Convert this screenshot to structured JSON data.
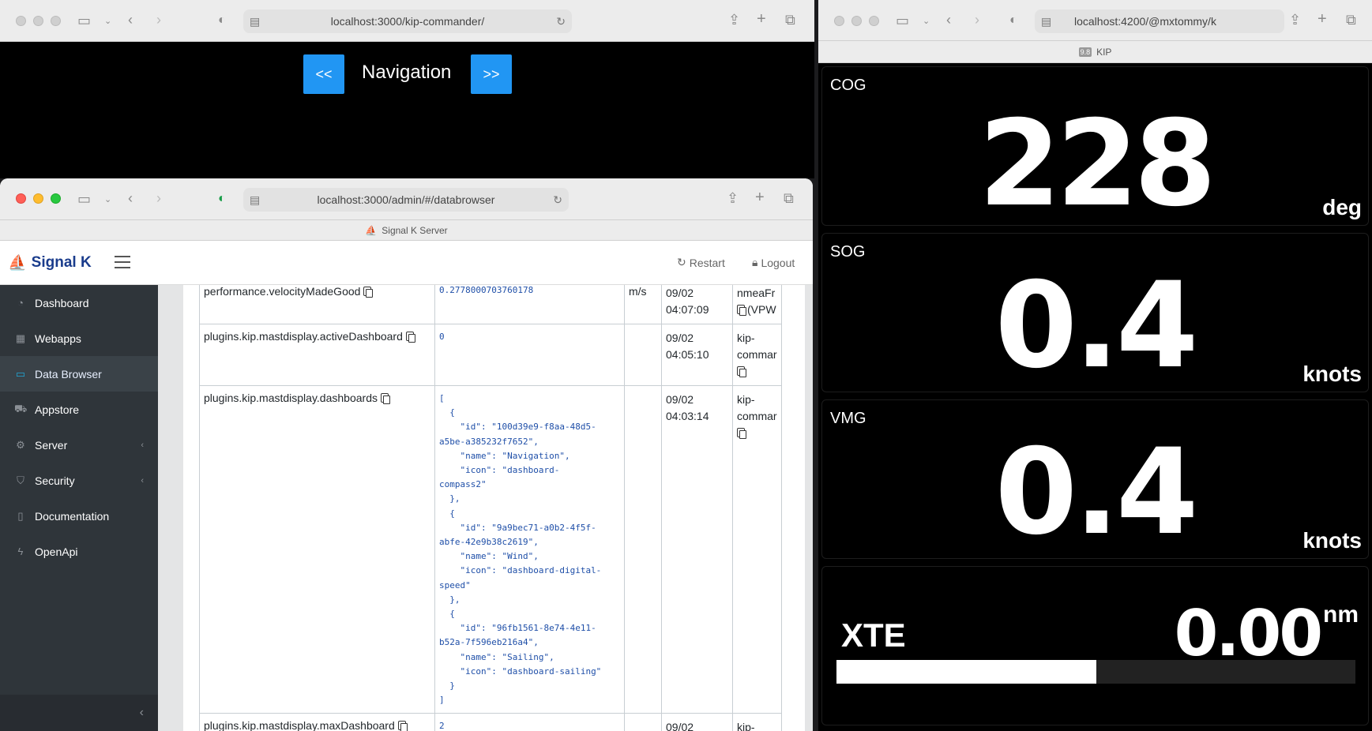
{
  "kip_commander": {
    "url": "localhost:3000/kip-commander/",
    "prev_label": "<<",
    "next_label": ">>",
    "title": "Navigation"
  },
  "signalk_window": {
    "url": "localhost:3000/admin/#/databrowser",
    "tab_title": "Signal K Server",
    "logo_text": "Signal K",
    "restart_label": "Restart",
    "logout_label": "Logout",
    "sidebar": [
      {
        "label": "Dashboard",
        "icon": "gauge-icon"
      },
      {
        "label": "Webapps",
        "icon": "grid-icon"
      },
      {
        "label": "Data Browser",
        "icon": "folder-icon"
      },
      {
        "label": "Appstore",
        "icon": "cart-icon"
      },
      {
        "label": "Server",
        "icon": "gear-icon"
      },
      {
        "label": "Security",
        "icon": "shield-icon"
      },
      {
        "label": "Documentation",
        "icon": "book-icon"
      },
      {
        "label": "OpenApi",
        "icon": "bolt-icon"
      }
    ],
    "rows": [
      {
        "path": "performance.velocityMadeGood",
        "value": "0.2778000703760178",
        "units": "m/s",
        "date": "09/02",
        "time": "04:07:09",
        "source1": "nmeaFr",
        "source2": "(VPW"
      },
      {
        "path": "plugins.kip.mastdisplay.activeDashboard",
        "value": "0",
        "units": "",
        "date": "09/02",
        "time": "04:05:10",
        "source1": "kip-",
        "source2": "commar"
      },
      {
        "path": "plugins.kip.mastdisplay.dashboards",
        "value": "[\n  {\n    \"id\": \"100d39e9-f8aa-48d5-\na5be-a385232f7652\",\n    \"name\": \"Navigation\",\n    \"icon\": \"dashboard-\ncompass2\"\n  },\n  {\n    \"id\": \"9a9bec71-a0b2-4f5f-\nabfe-42e9b38c2619\",\n    \"name\": \"Wind\",\n    \"icon\": \"dashboard-digital-\nspeed\"\n  },\n  {\n    \"id\": \"96fb1561-8e74-4e11-\nb52a-7f596eb216a4\",\n    \"name\": \"Sailing\",\n    \"icon\": \"dashboard-sailing\"\n  }\n]",
        "units": "",
        "date": "09/02",
        "time": "04:03:14",
        "source1": "kip-",
        "source2": "commar"
      },
      {
        "path": "plugins.kip.mastdisplay.maxDashboard",
        "value": "2",
        "units": "",
        "date": "09/02",
        "time": "",
        "source1": "kip-",
        "source2": ""
      }
    ]
  },
  "kip_window": {
    "url": "localhost:4200/@mxtommy/k",
    "tab_title": "KIP",
    "tab_badge": "9.8",
    "tiles": [
      {
        "label": "COG",
        "value": "228",
        "unit": "deg"
      },
      {
        "label": "SOG",
        "value": "0.4",
        "unit": "knots"
      },
      {
        "label": "VMG",
        "value": "0.4",
        "unit": "knots"
      }
    ],
    "xte": {
      "label": "XTE",
      "value": "0.00",
      "unit": "nm",
      "bar_fraction": 0.5
    }
  }
}
